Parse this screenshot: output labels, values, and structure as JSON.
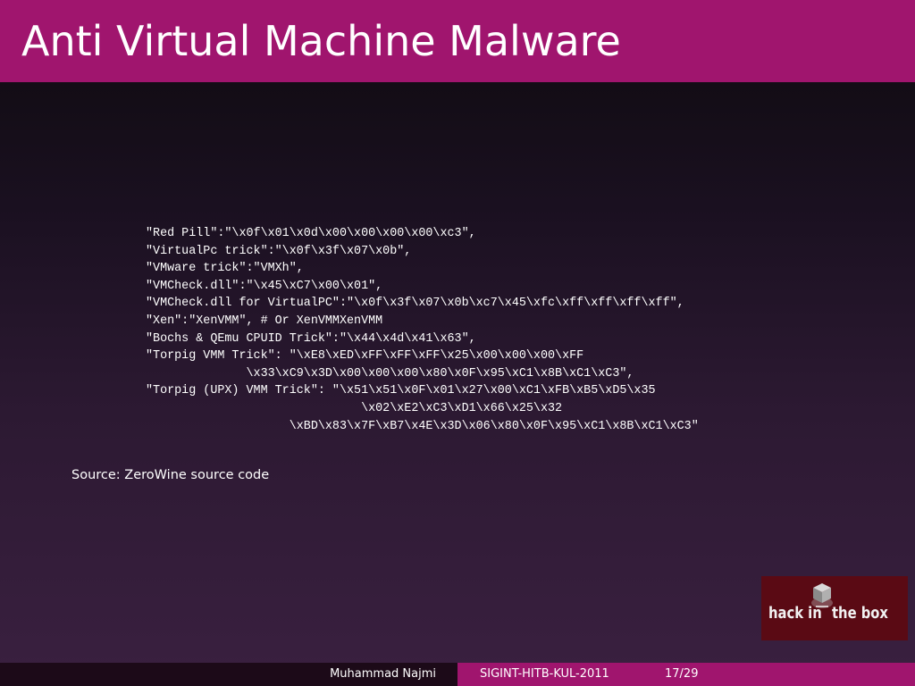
{
  "slide": {
    "title": "Anti Virtual Machine Malware",
    "code_lines": [
      "\"Red Pill\":\"\\x0f\\x01\\x0d\\x00\\x00\\x00\\x00\\xc3\",",
      "\"VirtualPc trick\":\"\\x0f\\x3f\\x07\\x0b\",",
      "\"VMware trick\":\"VMXh\",",
      "\"VMCheck.dll\":\"\\x45\\xC7\\x00\\x01\",",
      "\"VMCheck.dll for VirtualPC\":\"\\x0f\\x3f\\x07\\x0b\\xc7\\x45\\xfc\\xff\\xff\\xff\\xff\",",
      "\"Xen\":\"XenVMM\", # Or XenVMMXenVMM",
      "\"Bochs & QEmu CPUID Trick\":\"\\x44\\x4d\\x41\\x63\",",
      "\"Torpig VMM Trick\": \"\\xE8\\xED\\xFF\\xFF\\xFF\\x25\\x00\\x00\\x00\\xFF",
      "              \\x33\\xC9\\x3D\\x00\\x00\\x00\\x80\\x0F\\x95\\xC1\\x8B\\xC1\\xC3\",",
      "\"Torpig (UPX) VMM Trick\": \"\\x51\\x51\\x0F\\x01\\x27\\x00\\xC1\\xFB\\xB5\\xD5\\x35",
      "                              \\x02\\xE2\\xC3\\xD1\\x66\\x25\\x32",
      "                    \\xBD\\x83\\x7F\\xB7\\x4E\\x3D\\x06\\x80\\x0F\\x95\\xC1\\x8B\\xC1\\xC3\""
    ],
    "source_note": "Source: ZeroWine source code"
  },
  "logo": {
    "text_left": "hack in",
    "text_right": "the box",
    "icon": "cube-icon"
  },
  "footer": {
    "author": "Muhammad Najmi",
    "event": "SIGINT-HITB-KUL-2011",
    "page": "17/29"
  },
  "colors": {
    "accent": "#a0156e",
    "background_top": "#0e0a0e",
    "background_bottom": "#3a2040",
    "footer_dark": "#1c0a18",
    "text": "#ffffff",
    "logo_background": "#5a0a14"
  }
}
